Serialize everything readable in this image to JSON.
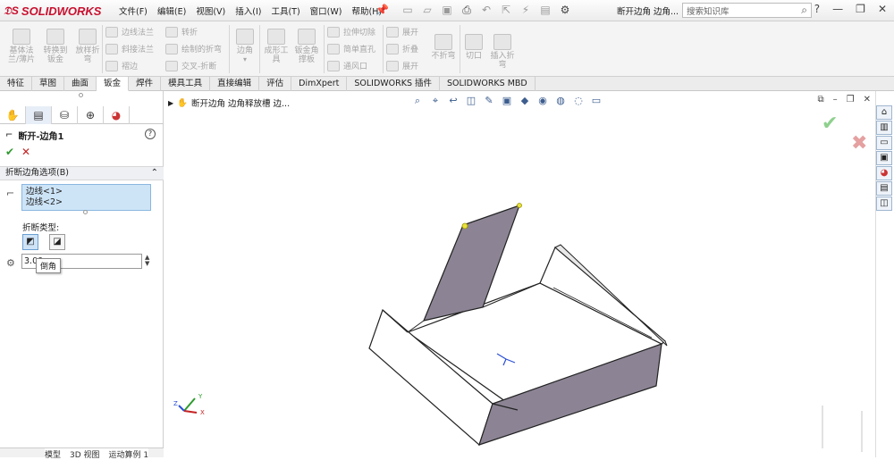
{
  "app": {
    "logo_text": "SOLIDWORKS",
    "doc_title": "断开边角 边角..."
  },
  "menu": [
    "文件(F)",
    "编辑(E)",
    "视图(V)",
    "插入(I)",
    "工具(T)",
    "窗口(W)",
    "帮助(H)"
  ],
  "search": {
    "placeholder": "搜索知识库"
  },
  "ribbon": {
    "large": [
      {
        "label": "基体法\n兰/薄片"
      },
      {
        "label": "转换到\n钣金"
      },
      {
        "label": "放样折\n弯"
      },
      {
        "label": "边角"
      },
      {
        "label": "成形工\n具"
      },
      {
        "label": "钣金角\n撑板"
      },
      {
        "label": "折叠"
      },
      {
        "label": "不折弯"
      },
      {
        "label": "切口"
      },
      {
        "label": "插入折\n弯"
      }
    ],
    "small": [
      {
        "label": "边线法兰"
      },
      {
        "label": "斜接法兰"
      },
      {
        "label": "褶边"
      },
      {
        "label": "转折"
      },
      {
        "label": "绘制的折弯"
      },
      {
        "label": "交叉-折断"
      },
      {
        "label": "拉伸切除"
      },
      {
        "label": "简单直孔"
      },
      {
        "label": "通风口"
      },
      {
        "label": "展开"
      },
      {
        "label": "展开"
      }
    ]
  },
  "tabs": [
    "特征",
    "草图",
    "曲面",
    "钣金",
    "焊件",
    "模具工具",
    "直接编辑",
    "评估",
    "DimXpert",
    "SOLIDWORKS 插件",
    "SOLIDWORKS MBD"
  ],
  "active_tab": "钣金",
  "property_manager": {
    "title": "断开-边角1",
    "group": "折断边角选项(B)",
    "selections": [
      "边线<1>",
      "边线<2>"
    ],
    "break_type_label": "折断类型:",
    "distance": "3.00",
    "tooltip": "倒角"
  },
  "bottom_tabs": [
    "模型",
    "3D 视图",
    "运动算例 1"
  ],
  "viewport": {
    "tree_label": "断开边角 边角释放槽 边..."
  },
  "colors": {
    "brand": "#c8102e",
    "part_face": "#8c8494",
    "accent": "#2a6fd6"
  }
}
